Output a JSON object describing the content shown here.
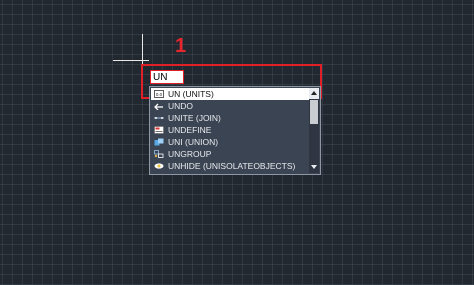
{
  "annotation": {
    "step_number": "1"
  },
  "command_line": {
    "value": "UN"
  },
  "autocomplete": {
    "items": [
      {
        "icon": "units-icon",
        "label": "UN (UNITS)"
      },
      {
        "icon": "undo-icon",
        "label": "UNDO"
      },
      {
        "icon": "join-icon",
        "label": "UNITE (JOIN)"
      },
      {
        "icon": "undefine-icon",
        "label": "UNDEFINE"
      },
      {
        "icon": "union-icon",
        "label": "UNI (UNION)"
      },
      {
        "icon": "ungroup-icon",
        "label": "UNGROUP"
      },
      {
        "icon": "unhide-icon",
        "label": "UNHIDE (UNISOLATEOBJECTS)"
      }
    ],
    "selected_index": 0
  },
  "colors": {
    "canvas_background": "#212830",
    "grid_line": "#3e4854",
    "highlight_red": "#e11f26",
    "list_background": "#3b4453",
    "list_text": "#e9ecf0"
  }
}
